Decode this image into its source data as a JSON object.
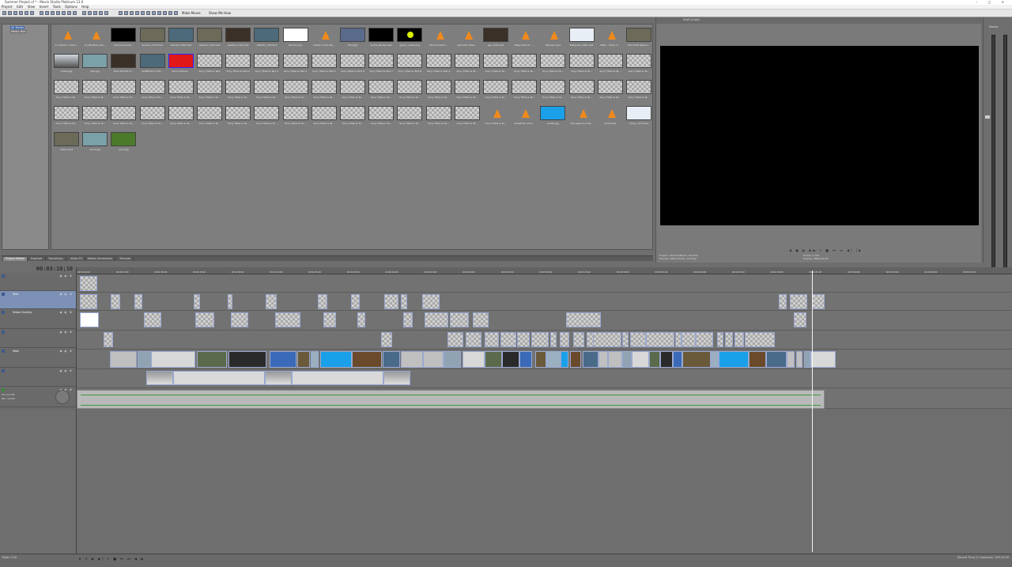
{
  "window": {
    "title": "Summer Project.vf * - Movie Studio Platinum 13.0",
    "buttons": "– □ ✕"
  },
  "menu": [
    "Project",
    "Edit",
    "View",
    "Insert",
    "Tools",
    "Options",
    "Help"
  ],
  "toolbar": {
    "make_movie": "Make Movie",
    "show_me_how": "Show Me How"
  },
  "explorer": {
    "tree_items": [
      "All Media",
      "Media Bins"
    ]
  },
  "media": {
    "rows": [
      [
        {
          "cap": "11 Harlem vocals...",
          "kind": "vlc"
        },
        {
          "cap": "12_Bluebonnets...",
          "kind": "vlc"
        },
        {
          "cap": "Alex Jones fadi...",
          "kind": "black"
        },
        {
          "cap": "Alexis1_c07t.mp4",
          "kind": "photo"
        },
        {
          "cap": "Alexis2_c09t.mp4",
          "kind": "photo2"
        },
        {
          "cap": "Alexis3_c12t.mp4",
          "kind": "photo"
        },
        {
          "cap": "Alexis4_c16t.mp4",
          "kind": "photo3"
        },
        {
          "cap": "Alitotto_c38.mp4",
          "kind": "photo2"
        },
        {
          "cap": "Border.png",
          "kind": "white"
        },
        {
          "cap": "Castle in the Sky...",
          "kind": "vlc"
        },
        {
          "cap": "Final.jpg",
          "kind": "photo4"
        },
        {
          "cap": "Game_Recap.mp4",
          "kind": "black"
        },
        {
          "cap": "green_matte.png",
          "kind": "yellowdot"
        },
        {
          "cap": "HereComesTh...",
          "kind": "vlc"
        },
        {
          "cap": "Jazz Intro Bass...",
          "kind": "vlc"
        },
        {
          "cap": "Jay_c24t.mp4",
          "kind": "photo3"
        },
        {
          "cap": "Magic Sword - ...",
          "kind": "vlc"
        },
        {
          "cap": "Marissa.mp4",
          "kind": "vlc"
        },
        {
          "cap": "Mariposa_c09t.mp4",
          "kind": "window"
        },
        {
          "cap": "MMA - Victor_T...",
          "kind": "vlc"
        },
        {
          "cap": "Microsoft Teams...",
          "kind": "photo"
        }
      ],
      [
        {
          "cap": "ocean.jpg",
          "kind": "gradient"
        },
        {
          "cap": "pier.jpg",
          "kind": "photo5"
        },
        {
          "cap": "Rock the Mic S...",
          "kind": "photo3"
        },
        {
          "cap": "SelfMade's Cofe...",
          "kind": "photo2"
        },
        {
          "cap": "Solid Colored...",
          "kind": "red"
        },
        {
          "cap": "Sony Titles & Text",
          "kind": "checker"
        },
        {
          "cap": "Sony Titles & Text 2",
          "kind": "checker"
        },
        {
          "cap": "Sony Titles & Text 3",
          "kind": "checker"
        },
        {
          "cap": "Sony Titles & Text 4",
          "kind": "checker"
        },
        {
          "cap": "Sony Titles & Text 5",
          "kind": "checker"
        },
        {
          "cap": "Sony Titles & Text 6",
          "kind": "checker"
        },
        {
          "cap": "Sony Titles & Text 7",
          "kind": "checker"
        },
        {
          "cap": "Sony Titles & Text 8",
          "kind": "checker"
        },
        {
          "cap": "Sony Titles & Text 9",
          "kind": "checker"
        },
        {
          "cap": "Sony Titles & Te...",
          "kind": "checker"
        },
        {
          "cap": "Sony Titles & Te...",
          "kind": "checker"
        },
        {
          "cap": "Sony Titles & Te...",
          "kind": "checker"
        },
        {
          "cap": "Sony Titles & Te...",
          "kind": "checker"
        },
        {
          "cap": "Sony Titles & Te...",
          "kind": "checker"
        },
        {
          "cap": "Sony Titles & Te...",
          "kind": "checker"
        },
        {
          "cap": "Sony Titles & Te...",
          "kind": "checker"
        }
      ],
      [
        {
          "cap": "Sony Titles & Te...",
          "kind": "checker"
        },
        {
          "cap": "Sony Titles & Te...",
          "kind": "checker"
        },
        {
          "cap": "Sony Titles & Te...",
          "kind": "checker"
        },
        {
          "cap": "Sony Titles & Te...",
          "kind": "checker"
        },
        {
          "cap": "Sony Titles & Te...",
          "kind": "checker"
        },
        {
          "cap": "Sony Titles & Te...",
          "kind": "checker"
        },
        {
          "cap": "Sony Titles & Te...",
          "kind": "checker"
        },
        {
          "cap": "Sony Titles & Te...",
          "kind": "checker"
        },
        {
          "cap": "Sony Titles & Te...",
          "kind": "checker"
        },
        {
          "cap": "Sony Titles & Te...",
          "kind": "checker"
        },
        {
          "cap": "Sony Titles & Te...",
          "kind": "checker"
        },
        {
          "cap": "Sony Titles & Te...",
          "kind": "checker"
        },
        {
          "cap": "Sony Titles & Te...",
          "kind": "checker"
        },
        {
          "cap": "Sony Titles & Te...",
          "kind": "checker"
        },
        {
          "cap": "Sony Titles & Te...",
          "kind": "checker"
        },
        {
          "cap": "Sony Titles & Te...",
          "kind": "checker"
        },
        {
          "cap": "Sony Titles & Te...",
          "kind": "checker"
        },
        {
          "cap": "Sony Titles & Te...",
          "kind": "checker"
        },
        {
          "cap": "Sony Titles & Te...",
          "kind": "checker"
        },
        {
          "cap": "Sony Titles & Te...",
          "kind": "checker"
        },
        {
          "cap": "Sony Titles & Te...",
          "kind": "checker"
        }
      ],
      [
        {
          "cap": "Sony Titles & Te...",
          "kind": "checker"
        },
        {
          "cap": "Sony Titles & Te...",
          "kind": "checker"
        },
        {
          "cap": "Sony Titles & Te...",
          "kind": "checker"
        },
        {
          "cap": "Sony Titles & Te...",
          "kind": "checker"
        },
        {
          "cap": "Sony Titles & Te...",
          "kind": "checker"
        },
        {
          "cap": "Sony Titles & Te...",
          "kind": "checker"
        },
        {
          "cap": "Sony Titles & Te...",
          "kind": "checker"
        },
        {
          "cap": "Sony Titles & Te...",
          "kind": "checker"
        },
        {
          "cap": "Sony Titles & Te...",
          "kind": "checker"
        },
        {
          "cap": "Sony Titles & Te...",
          "kind": "checker"
        },
        {
          "cap": "Sony Titles & Te...",
          "kind": "checker"
        },
        {
          "cap": "Sony Titles & Te...",
          "kind": "checker"
        },
        {
          "cap": "Sony Titles & Te...",
          "kind": "checker"
        },
        {
          "cap": "Sony Titles & Te...",
          "kind": "checker"
        },
        {
          "cap": "Sony Titles & Te...",
          "kind": "checker"
        },
        {
          "cap": "Sony Titles & Te...",
          "kind": "vlc"
        },
        {
          "cap": "stoleFlutt (10.4...",
          "kind": "vlc"
        },
        {
          "cap": "studio.jpg",
          "kind": "blue"
        },
        {
          "cap": "The Legend of Ze...",
          "kind": "vlc"
        },
        {
          "cap": "Unity.mp4",
          "kind": "vlc"
        },
        {
          "cap": "Vicky_c37t.mp4",
          "kind": "window"
        }
      ],
      [
        {
          "cap": "water.mp4",
          "kind": "photo"
        },
        {
          "cap": "wood.jpg",
          "kind": "photo5"
        },
        {
          "cap": "yard.jpg",
          "kind": "green"
        }
      ]
    ]
  },
  "tabs": [
    "Project Media",
    "Explorer",
    "Transitions",
    "Video FX",
    "Media Generators",
    "Trimmer"
  ],
  "preview": {
    "toolbar_label": "Draft (Auto)",
    "info_left": [
      "Project: 1920x1080x32, 29.970p",
      "Preview: 480x270x32, 29.970p"
    ],
    "info_right": [
      "Frame: 5,799",
      "Display: 386x216x32"
    ],
    "transport": "◀ ● ▶ ▶▶ ⏸ ■ ⏮ ⏭ ◀| |▶"
  },
  "meter": {
    "label": "Master",
    "db_scale": [
      "-3",
      "-6",
      "-9",
      "-12",
      "-15",
      "-18",
      "-21",
      "-24",
      "-27",
      "-30",
      "-33",
      "-36",
      "-39",
      "-42",
      "-45",
      "-48",
      "-51",
      "-54",
      "-57"
    ]
  },
  "timeline": {
    "time": "00:03:10;10",
    "ruler": [
      "00:00:00;00",
      "00:00:15;00",
      "00:00:30;00",
      "00:00:45;00",
      "00:01:00;00",
      "00:01:15;00",
      "00:01:30;00",
      "00:01:45;00",
      "00:02:00;00",
      "00:02:15;00",
      "00:02:30;00",
      "00:02:45;00",
      "00:03:00;00",
      "00:03:15;00",
      "00:03:30;00",
      "00:03:45;00",
      "00:04:00;00",
      "00:04:15;00",
      "00:04:30;00",
      "00:04:45;00",
      "00:05:00;00",
      "00:05:15;00",
      "00:05:30;00",
      "00:05:45;00"
    ],
    "tracks": [
      {
        "name": "",
        "kind": "video"
      },
      {
        "name": "Text",
        "kind": "video",
        "selected": true
      },
      {
        "name": "Video Overlay",
        "kind": "video"
      },
      {
        "name": "",
        "kind": "video"
      },
      {
        "name": "Main",
        "kind": "video"
      },
      {
        "name": "",
        "kind": "video"
      },
      {
        "name": "",
        "kind": "audio",
        "vol": "Vol: 0.0 dB",
        "pan": "Pan: Center"
      }
    ]
  },
  "status": {
    "rate": "Rate: 0.00",
    "transport": "⏺ ↺ ▶ ▶| ⏸ ■ ⏮ ⏭ ◀ ▶",
    "record_time": "Record Time (2 channels): 139:12:55"
  }
}
